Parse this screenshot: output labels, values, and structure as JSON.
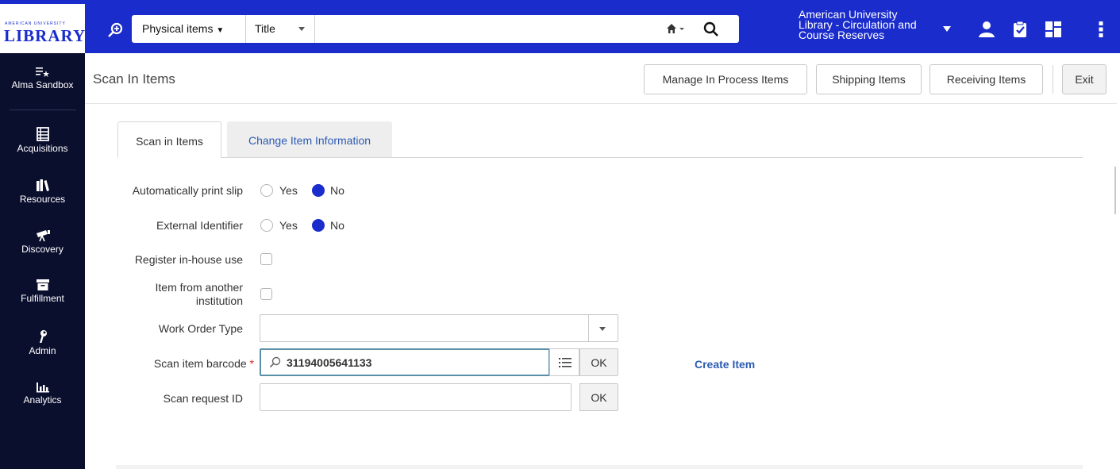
{
  "topbar": {
    "logo_small": "AMERICAN UNIVERSITY",
    "logo_big": "LIBRARY",
    "search_type": "Physical items",
    "search_field": "Title",
    "search_value": "",
    "institution": "American University Library - Circulation and Course Reserves",
    "accent_color": "#1a2ccc"
  },
  "sidebar": {
    "items": [
      {
        "label": "Alma Sandbox",
        "icon": "list-star-icon"
      },
      {
        "label": "Acquisitions",
        "icon": "ledger-icon"
      },
      {
        "label": "Resources",
        "icon": "books-icon"
      },
      {
        "label": "Discovery",
        "icon": "telescope-icon"
      },
      {
        "label": "Fulfillment",
        "icon": "archive-box-icon"
      },
      {
        "label": "Admin",
        "icon": "wrench-icon"
      },
      {
        "label": "Analytics",
        "icon": "bar-chart-icon"
      }
    ]
  },
  "header": {
    "title": "Scan In Items",
    "buttons": {
      "manage": "Manage In Process Items",
      "shipping": "Shipping Items",
      "receiving": "Receiving Items",
      "exit": "Exit"
    }
  },
  "tabs": {
    "active": "Scan in Items",
    "inactive": "Change Item Information"
  },
  "form": {
    "auto_print_label": "Automatically print slip",
    "external_id_label": "External Identifier",
    "yes": "Yes",
    "no": "No",
    "auto_print_value": "No",
    "external_id_value": "No",
    "inhouse_label": "Register in-house use",
    "other_inst_label_1": "Item from another",
    "other_inst_label_2": "institution",
    "work_order_label": "Work Order Type",
    "work_order_value": "",
    "barcode_label": "Scan item barcode",
    "barcode_required": "*",
    "barcode_value": "31194005641133",
    "request_label": "Scan request ID",
    "request_value": "",
    "ok": "OK",
    "create_item": "Create Item"
  }
}
